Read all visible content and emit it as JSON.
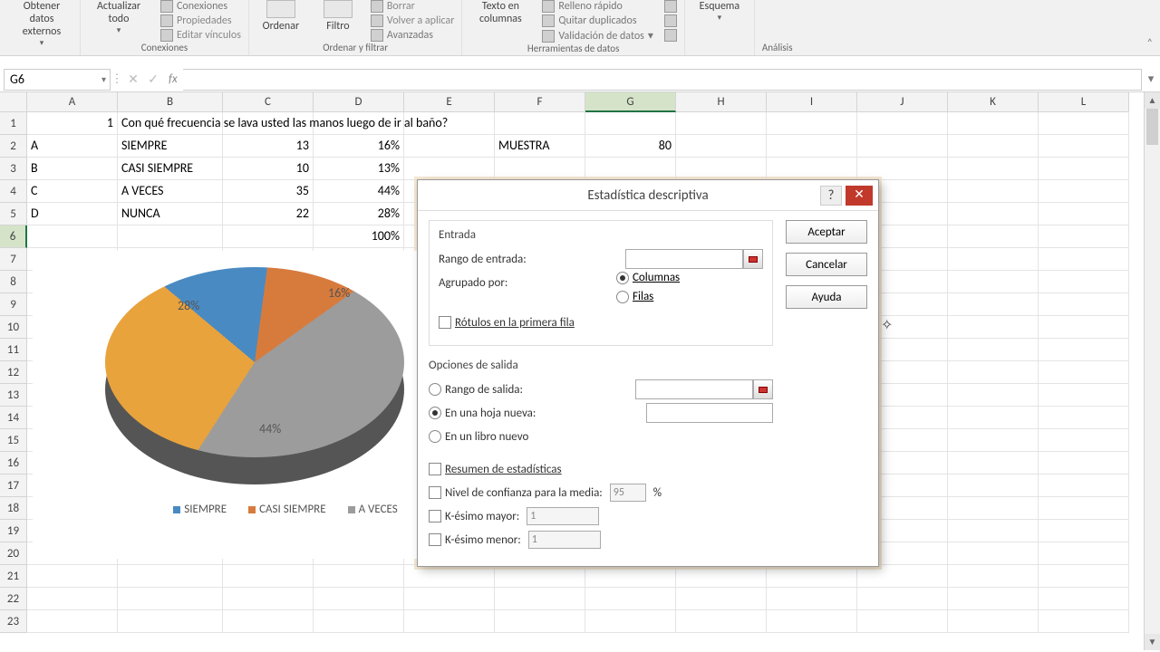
{
  "ribbon": {
    "groups": {
      "externos": {
        "big": "Obtener datos\nexternos"
      },
      "conexiones": {
        "label": "Conexiones",
        "big": "Actualizar\ntodo",
        "items": [
          "Conexiones",
          "Propiedades",
          "Editar vínculos"
        ]
      },
      "ordenar_filtrar": {
        "label": "Ordenar y filtrar",
        "items": [
          "Ordenar",
          "Filtro"
        ],
        "sub": [
          "Borrar",
          "Volver a aplicar",
          "Avanzadas"
        ]
      },
      "herramientas": {
        "label": "Herramientas de datos",
        "big": "Texto en\ncolumnas",
        "items": [
          "Relleno rápido",
          "Quitar duplicados",
          "Validación de datos"
        ]
      },
      "esquema": {
        "label": "Esquema",
        "big": "Esquema"
      },
      "analisis": {
        "label": "Análisis"
      }
    }
  },
  "name_box": "G6",
  "columns": [
    "A",
    "B",
    "C",
    "D",
    "E",
    "F",
    "G",
    "H",
    "I",
    "J",
    "K",
    "L"
  ],
  "rows_count": 23,
  "active_row": 6,
  "active_col": "G",
  "data": {
    "r1": {
      "A": "1",
      "B": "Con qué frecuencia se lava usted  las manos luego de ir al baño?"
    },
    "r2": {
      "A": "A",
      "B": "SIEMPRE",
      "C": "13",
      "D": "16%",
      "F": "MUESTRA",
      "G": "80"
    },
    "r3": {
      "A": "B",
      "B": "CASI SIEMPRE",
      "C": "10",
      "D": "13%"
    },
    "r4": {
      "A": "C",
      "B": "A VECES",
      "C": "35",
      "D": "44%"
    },
    "r5": {
      "A": "D",
      "B": "NUNCA",
      "C": "22",
      "D": "28%"
    },
    "r6": {
      "D": "100%"
    }
  },
  "chart_data": {
    "type": "pie",
    "title": "",
    "categories": [
      "SIEMPRE",
      "CASI SIEMPRE",
      "A VECES",
      "NUNCA"
    ],
    "values": [
      16,
      13,
      44,
      28
    ],
    "colors": [
      "#4a8ac2",
      "#d77b3d",
      "#9c9c9c",
      "#e8a33d"
    ],
    "labels": [
      "16%",
      "",
      "44%",
      "28%"
    ]
  },
  "legend": [
    "SIEMPRE",
    "CASI SIEMPRE",
    "A VECES"
  ],
  "dialog": {
    "title": "Estadística descriptiva",
    "buttons": {
      "accept": "Aceptar",
      "cancel": "Cancelar",
      "help": "Ayuda"
    },
    "entrada": {
      "section": "Entrada",
      "rango": "Rango de entrada:",
      "agrupado": "Agrupado por:",
      "columnas": "Columnas",
      "filas": "Filas",
      "rotulos": "Rótulos en la primera fila"
    },
    "salida": {
      "section": "Opciones de salida",
      "rango": "Rango de salida:",
      "hoja": "En una hoja nueva:",
      "libro": "En un libro nuevo",
      "resumen": "Resumen de estadísticas",
      "confianza": "Nivel de confianza para la media:",
      "conf_val": "95",
      "pct": "%",
      "kmayor": "K-ésimo mayor:",
      "kmenor": "K-ésimo menor:",
      "k_val": "1"
    }
  }
}
